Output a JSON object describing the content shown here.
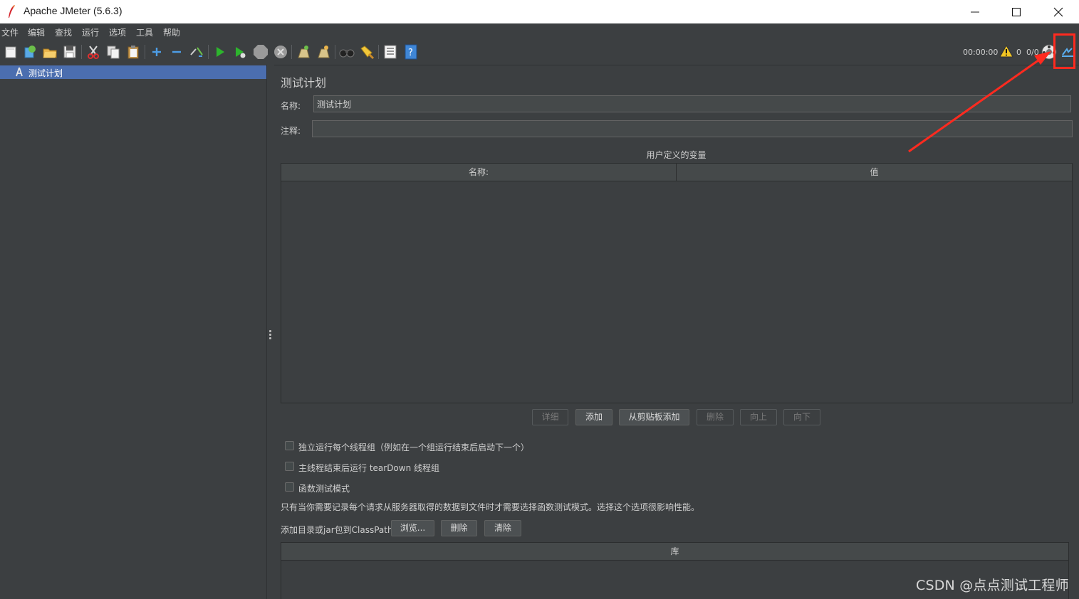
{
  "window": {
    "title": "Apache JMeter (5.6.3)"
  },
  "menu": [
    "文件",
    "编辑",
    "查找",
    "运行",
    "选项",
    "工具",
    "帮助"
  ],
  "toolbar": {
    "icons": [
      "new-icon",
      "templates-icon",
      "open-icon",
      "save-icon",
      "cut-icon",
      "copy-icon",
      "paste-icon",
      "expand-icon",
      "collapse-icon",
      "toggle-icon",
      "start-icon",
      "start-no-pause-icon",
      "stop-icon",
      "shutdown-icon",
      "clear-icon",
      "clear-all-icon",
      "search-icon",
      "reset-search-icon",
      "function-helper-icon",
      "help-icon"
    ],
    "timer": "00:00:00",
    "warning_count": "0",
    "thread_count": "0/0",
    "accent_color": "#ff2a1f"
  },
  "tree": {
    "items": [
      {
        "label": "测试计划",
        "selected": true
      }
    ]
  },
  "panel": {
    "title": "测试计划",
    "name_label": "名称:",
    "name_value": "测试计划",
    "comment_label": "注释:",
    "comment_value": "",
    "variables_title": "用户定义的变量",
    "variables_columns": [
      "名称:",
      "值"
    ],
    "buttons": {
      "detail": "详细",
      "add": "添加",
      "add_from_clipboard": "从剪贴板添加",
      "delete": "删除",
      "up": "向上",
      "down": "向下"
    },
    "checkboxes": [
      "独立运行每个线程组（例如在一个组运行结束后启动下一个）",
      "主线程结束后运行 tearDown 线程组",
      "函数测试模式"
    ],
    "functional_note": "只有当你需要记录每个请求从服务器取得的数据到文件时才需要选择函数测试模式。选择这个选项很影响性能。",
    "classpath_label": "添加目录或jar包到ClassPath",
    "classpath_buttons": {
      "browse": "浏览...",
      "delete": "删除",
      "clear": "清除"
    },
    "library_column": "库"
  },
  "watermark": "CSDN @点点测试工程师"
}
